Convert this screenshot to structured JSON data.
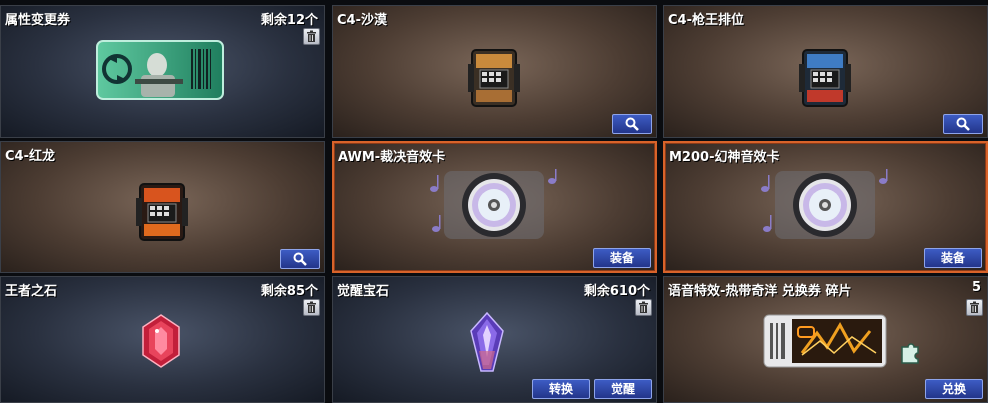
{
  "cards": [
    {
      "title": "属性变更券",
      "count": "剩余12个"
    },
    {
      "title": "C4-沙漠"
    },
    {
      "title": "C4-枪王排位"
    },
    {
      "title": "C4-红龙"
    },
    {
      "title": "AWM-裁决音效卡",
      "button": "装备"
    },
    {
      "title": "M200-幻神音效卡",
      "button": "装备"
    },
    {
      "title": "王者之石",
      "count": "剩余85个"
    },
    {
      "title": "觉醒宝石",
      "count": "剩余610个",
      "button1": "转换",
      "button2": "觉醒"
    },
    {
      "title": "语音特效-热带奇洋 兑换券 碎片",
      "count": "5",
      "button": "兑换"
    }
  ],
  "icons": [
    "trash-icon",
    "magnifier-icon",
    "music-note-icon",
    "disc-icon",
    "c4-bomb-icon",
    "gem-icon",
    "puzzle-piece-icon"
  ],
  "colors": {
    "selected_border": "#d8632a",
    "button_blue": "#2f47a8"
  }
}
